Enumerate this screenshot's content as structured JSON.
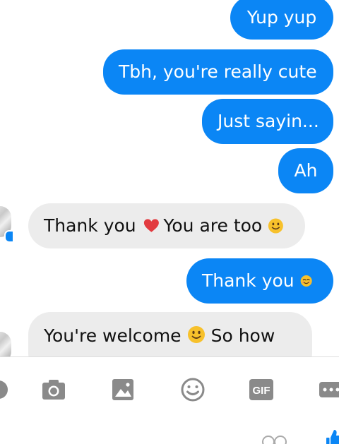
{
  "messages": [
    {
      "direction": "out",
      "text": "Yup yup"
    },
    {
      "direction": "out",
      "text": "Tbh, you're really cute"
    },
    {
      "direction": "out",
      "text": "Just sayin..."
    },
    {
      "direction": "out",
      "text": "Ah"
    },
    {
      "direction": "in",
      "text_before": "Thank you",
      "text_middle": "You are too",
      "emojis": [
        "red-heart",
        "slightly-smiling-face"
      ]
    },
    {
      "direction": "out",
      "text": "Thank you",
      "emojis": [
        "smiling-face-with-smiling-eyes"
      ]
    },
    {
      "direction": "in",
      "text_before": "You're welcome",
      "text_after": "So how",
      "emojis": [
        "slightly-smiling-face"
      ],
      "partial": true
    }
  ],
  "composer": {
    "icons": [
      "camera-icon",
      "gallery-icon",
      "emoji-icon",
      "gif-icon",
      "more-icon"
    ],
    "gif_label": "GIF"
  },
  "colors": {
    "outgoing_bubble": "#0b86f5",
    "incoming_bubble": "#ececec",
    "icon_gray": "#8a8a8a"
  }
}
